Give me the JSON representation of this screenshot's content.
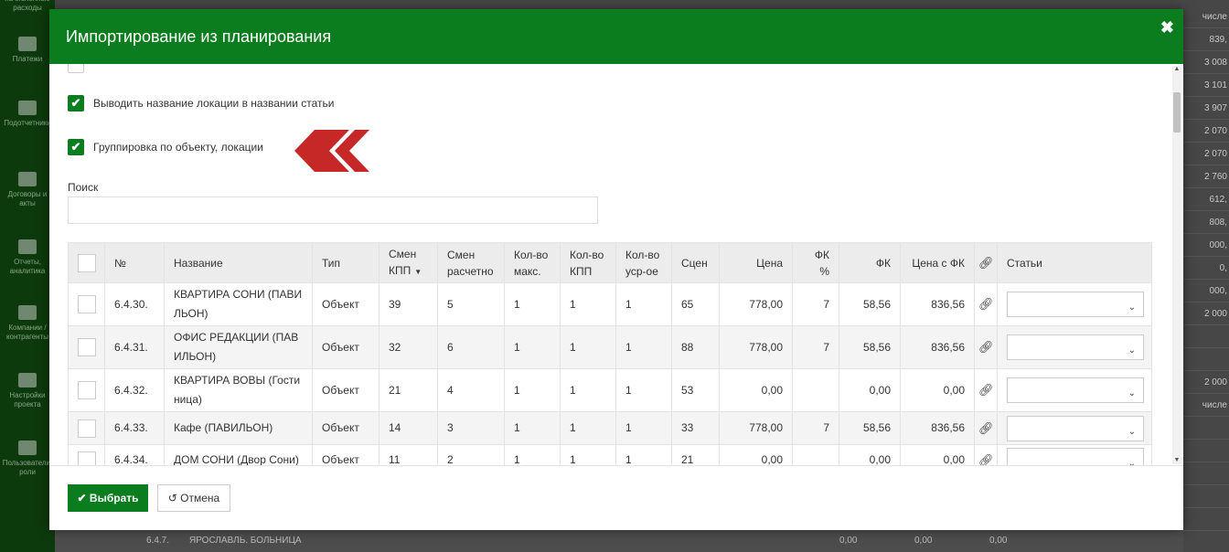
{
  "background": {
    "sidebar": [
      {
        "label": "начисленные расходы",
        "icon": "money-icon"
      },
      {
        "label": "Платежи",
        "icon": "card-icon"
      },
      {
        "label": "Подотчетники",
        "icon": "briefcase-icon"
      },
      {
        "label": "Договоры и акты",
        "icon": "list-icon"
      },
      {
        "label": "Отчеты, аналитика",
        "icon": "chart-icon"
      },
      {
        "label": "Компании / контрагенты",
        "icon": "user-icon"
      },
      {
        "label": "Настройки проекта",
        "icon": "sliders-icon"
      },
      {
        "label": "Пользователи, роли",
        "icon": "users-icon"
      }
    ],
    "right_column": [
      "числе",
      "839,",
      "3 008",
      "3 101",
      "3 907",
      "2 070",
      "2 070",
      "2 760",
      "612,",
      "808,",
      "000,",
      "0,",
      "000,",
      "2 000",
      "",
      "",
      "2 000",
      "числе",
      "",
      "",
      "",
      "",
      "",
      ""
    ],
    "bottom_row": {
      "number": "6.4.7.",
      "name": "ЯРОСЛАВЛЬ. БОЛЬНИЦА",
      "v1": "0,00",
      "v2": "0,00",
      "v3": "0,00"
    }
  },
  "modal": {
    "title": "Импортирование из планирования",
    "close_glyph": "✖",
    "options": [
      {
        "label": "Выводить название локации в названии статьи",
        "checked": true
      },
      {
        "label": "Группировка по объекту, локации",
        "checked": true
      }
    ],
    "search": {
      "label": "Поиск",
      "value": "",
      "placeholder": ""
    },
    "table": {
      "headers": [
        "",
        "№",
        "Название",
        "Тип",
        "Смен КПП",
        "Смен расчетно",
        "Кол-во макс.",
        "Кол-во КПП",
        "Кол-во уср-ое",
        "Сцен",
        "Цена",
        "ФК %",
        "ФК",
        "Цена с ФК",
        "",
        "Статьи"
      ],
      "rows": [
        {
          "num": "6.4.30.",
          "name": "КВАРТИРА СОНИ (ПАВИ ЛЬОН)",
          "type": "Объект",
          "kpp": "39",
          "calc": "5",
          "max": "1",
          "qkpp": "1",
          "avg": "1",
          "scen": "65",
          "price": "778,00",
          "fkp": "7",
          "fk": "58,56",
          "pricefk": "836,56"
        },
        {
          "num": "6.4.31.",
          "name": "ОФИС РЕДАКЦИИ (ПАВ ИЛЬОН)",
          "type": "Объект",
          "kpp": "32",
          "calc": "6",
          "max": "1",
          "qkpp": "1",
          "avg": "1",
          "scen": "88",
          "price": "778,00",
          "fkp": "7",
          "fk": "58,56",
          "pricefk": "836,56"
        },
        {
          "num": "6.4.32.",
          "name": "КВАРТИРА ВОВЫ (Гости ница)",
          "type": "Объект",
          "kpp": "21",
          "calc": "4",
          "max": "1",
          "qkpp": "1",
          "avg": "1",
          "scen": "53",
          "price": "0,00",
          "fkp": "",
          "fk": "0,00",
          "pricefk": "0,00"
        },
        {
          "num": "6.4.33.",
          "name": "Кафе (ПАВИЛЬОН)",
          "type": "Объект",
          "kpp": "14",
          "calc": "3",
          "max": "1",
          "qkpp": "1",
          "avg": "1",
          "scen": "33",
          "price": "778,00",
          "fkp": "7",
          "fk": "58,56",
          "pricefk": "836,56"
        },
        {
          "num": "6.4.34.",
          "name": "ДОМ СОНИ (Двор Сони)",
          "type": "Объект",
          "kpp": "11",
          "calc": "2",
          "max": "1",
          "qkpp": "1",
          "avg": "1",
          "scen": "21",
          "price": "0,00",
          "fkp": "",
          "fk": "0,00",
          "pricefk": "0,00"
        }
      ]
    },
    "footer": {
      "select_label": "Выбрать",
      "cancel_label": "Отмена"
    }
  },
  "colors": {
    "brand_green": "#0b7d1f",
    "annotation_red": "#c62828"
  }
}
